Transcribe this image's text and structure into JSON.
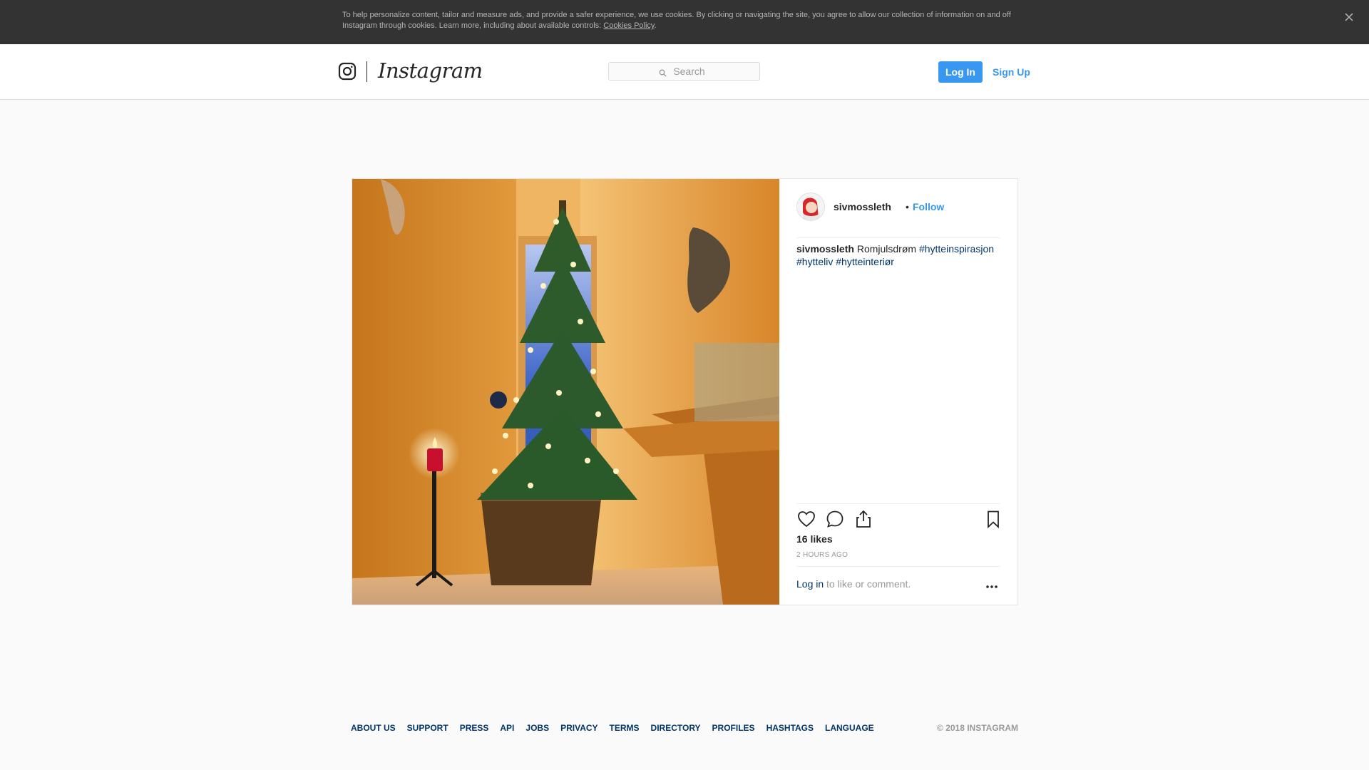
{
  "cookie_banner": {
    "text_line1": "To help personalize content, tailor and measure ads, and provide a safer experience, we use cookies. By clicking or navigating the site, you agree to allow our collection of information on and off",
    "text_line2": "Instagram through cookies. Learn more, including about available controls: ",
    "policy_link": "Cookies Policy",
    "period": ".",
    "close_icon": "close-icon"
  },
  "header": {
    "logo_icon": "instagram-camera-icon",
    "wordmark": "Instagram",
    "search": {
      "placeholder": "Search",
      "value": ""
    },
    "login_label": "Log In",
    "signup_label": "Sign Up",
    "accent_color": "#3897f0"
  },
  "post": {
    "username": "sivmossleth",
    "separator": "•",
    "follow_label": "Follow",
    "caption": {
      "user": "sivmossleth",
      "text": "Romjulsdrøm",
      "hashtags": [
        "#hytteinspirasjon",
        "#hytteliv",
        "#hytteinteriør"
      ]
    },
    "icons": [
      "heart-icon",
      "comment-icon",
      "share-icon",
      "bookmark-icon",
      "more-options-icon"
    ],
    "likes": "16 likes",
    "timestamp": "2 HOURS AGO",
    "login_link": "Log in",
    "login_suffix": " to like or comment."
  },
  "footer": {
    "links": [
      "ABOUT US",
      "SUPPORT",
      "PRESS",
      "API",
      "JOBS",
      "PRIVACY",
      "TERMS",
      "DIRECTORY",
      "PROFILES",
      "HASHTAGS",
      "LANGUAGE"
    ],
    "copyright": "© 2018 INSTAGRAM"
  }
}
